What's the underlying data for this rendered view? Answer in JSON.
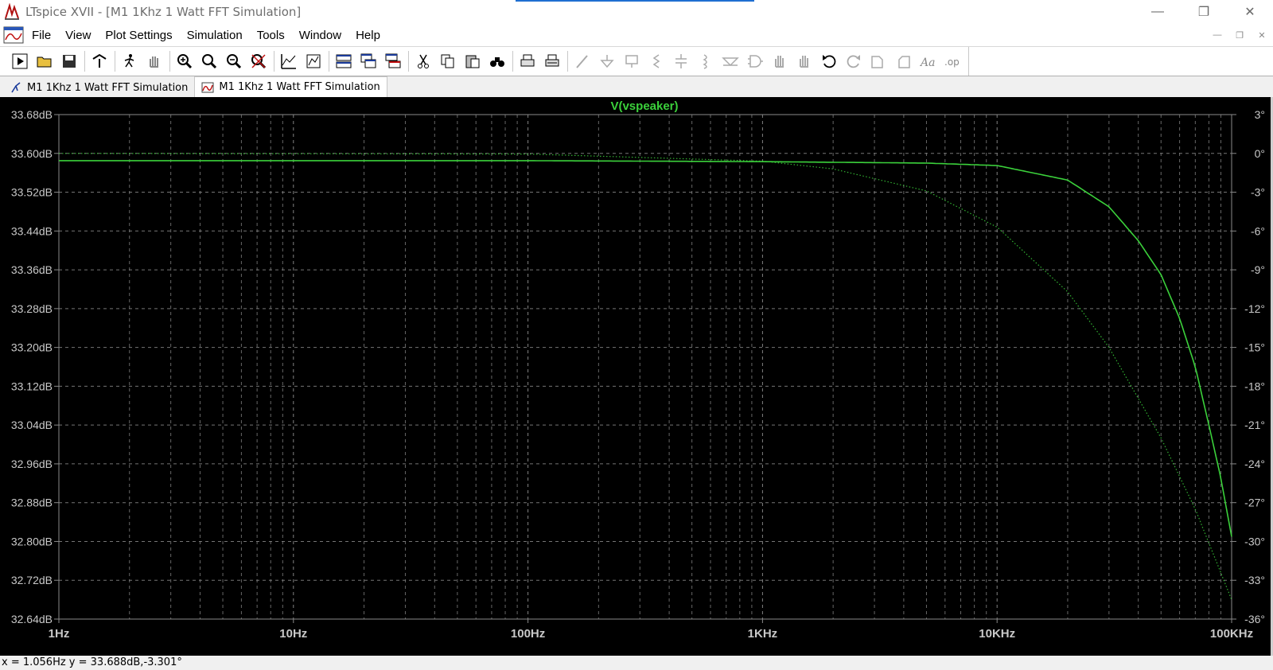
{
  "window": {
    "title": "LTspice XVII - [M1 1Khz 1 Watt FFT Simulation]",
    "controls": [
      "minimize",
      "restore",
      "close"
    ]
  },
  "menu": {
    "items": [
      "File",
      "View",
      "Plot Settings",
      "Simulation",
      "Tools",
      "Window",
      "Help"
    ]
  },
  "toolbar": {
    "icons": [
      "run-icon",
      "open-icon",
      "save-icon",
      "control-panel-icon",
      "pick-nodes-icon",
      "pan-hand-icon",
      "zoom-in-icon",
      "zoom-area-icon",
      "zoom-out-icon",
      "zoom-cancel-icon",
      "autorange-icon",
      "mark-icon",
      "tile-horizontal-icon",
      "cascade-icon",
      "tile-vertical-icon",
      "cut-icon",
      "copy-icon",
      "paste-icon",
      "find-icon",
      "print-icon",
      "print-preview-icon",
      "wire-icon",
      "ground-icon",
      "label-icon",
      "resistor-icon",
      "capacitor-icon",
      "inductor-icon",
      "diode-icon",
      "component-icon",
      "move-icon",
      "drag-icon",
      "undo-icon",
      "redo-icon",
      "rotate-icon",
      "mirror-icon",
      "text-icon",
      "spice-directive-icon"
    ]
  },
  "tabs": [
    {
      "label": "M1 1Khz 1 Watt FFT Simulation",
      "kind": "schematic",
      "active": false
    },
    {
      "label": "M1 1Khz 1 Watt FFT Simulation",
      "kind": "waveform",
      "active": true
    }
  ],
  "colors": {
    "trace": "#3bd13b",
    "grid": "#8a8a8a",
    "axis_text": "#c8c8c8",
    "plot_bg": "#000000"
  },
  "chart_data": {
    "type": "line",
    "title": "V(vspeaker)",
    "x_scale": "log",
    "xlim_hz": [
      1,
      100000
    ],
    "x_ticks": [
      "1Hz",
      "10Hz",
      "100Hz",
      "1KHz",
      "10KHz",
      "100KHz"
    ],
    "left_axis": {
      "ylim_db": [
        32.64,
        33.68
      ],
      "ticks": [
        "33.68dB",
        "33.60dB",
        "33.52dB",
        "33.44dB",
        "33.36dB",
        "33.28dB",
        "33.20dB",
        "33.12dB",
        "33.04dB",
        "32.96dB",
        "32.88dB",
        "32.80dB",
        "32.72dB",
        "32.64dB"
      ]
    },
    "right_axis": {
      "ylim_deg": [
        -36,
        3
      ],
      "ticks": [
        "3°",
        "0°",
        "-3°",
        "-6°",
        "-9°",
        "-12°",
        "-15°",
        "-18°",
        "-21°",
        "-24°",
        "-27°",
        "-30°",
        "-33°",
        "-36°"
      ]
    },
    "grid": true,
    "series": [
      {
        "name": "V(vspeaker)",
        "quantity": "magnitude",
        "style": "solid",
        "x": [
          1,
          10,
          100,
          1000,
          5000,
          10000,
          20000,
          30000,
          40000,
          50000,
          60000,
          70000,
          80000,
          90000,
          100000
        ],
        "y": [
          33.585,
          33.585,
          33.585,
          33.583,
          33.58,
          33.575,
          33.545,
          33.49,
          33.42,
          33.35,
          33.26,
          33.16,
          33.04,
          32.93,
          32.81
        ]
      },
      {
        "name": "V(vspeaker)",
        "quantity": "phase",
        "style": "dotted",
        "x": [
          1,
          100,
          1000,
          2000,
          5000,
          10000,
          20000,
          30000,
          50000,
          70000,
          100000
        ],
        "y": [
          0,
          -0.05,
          -0.6,
          -1.2,
          -2.9,
          -5.7,
          -10.7,
          -15.0,
          -22.0,
          -27.5,
          -34.5
        ]
      }
    ]
  },
  "status": {
    "readout": "x = 1.056Hz    y = 33.688dB,-3.301°"
  }
}
